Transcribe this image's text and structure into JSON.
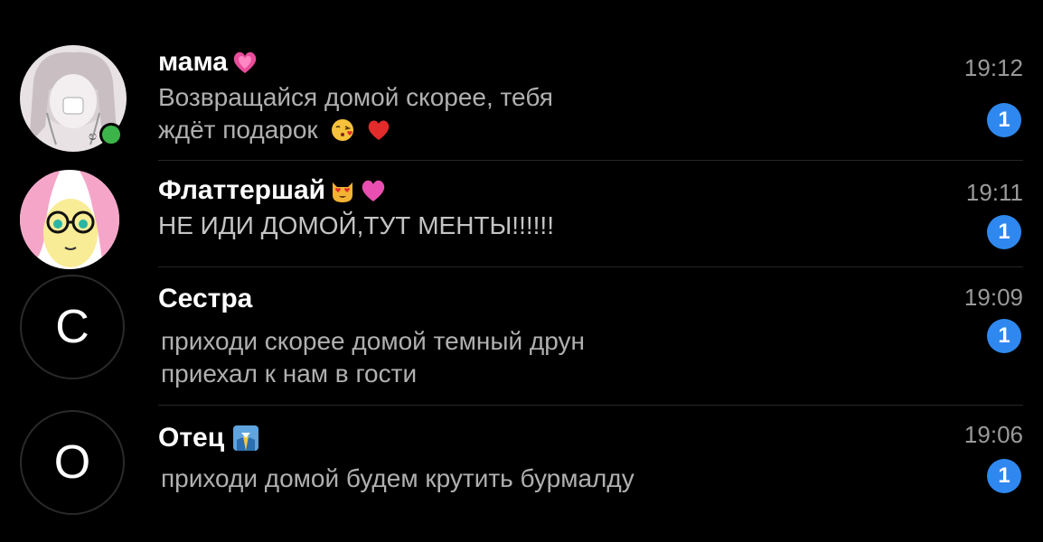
{
  "colors": {
    "background": "#000000",
    "badge": "#2f88f0",
    "online": "#3cb44a"
  },
  "chats": [
    {
      "name": "мама",
      "name_emoji": "sparkling-heart",
      "message_line1": "Возвращайся домой скорее, тебя",
      "message_line2": "ждёт подарок",
      "message_emoji": [
        "kiss-face",
        "red-heart"
      ],
      "time": "19:12",
      "unread": "1",
      "online": true
    },
    {
      "name": "Флаттершай",
      "name_emoji": [
        "heart-eyes-cat",
        "pink-heart"
      ],
      "message_line1": "НЕ ИДИ ДОМОЙ,ТУТ МЕНТЫ!!!!!!",
      "time": "19:11",
      "unread": "1"
    },
    {
      "name": "Сестра",
      "avatar_letter": "С",
      "message_line1": "приходи скорее домой темный друн",
      "message_line2": "приехал к нам в гости",
      "time": "19:09",
      "unread": "1"
    },
    {
      "name": "Отец",
      "name_emoji": "office-worker",
      "avatar_letter": "О",
      "message_line1": "приходи домой будем крутить бурмалду",
      "time": "19:06",
      "unread": "1"
    }
  ]
}
